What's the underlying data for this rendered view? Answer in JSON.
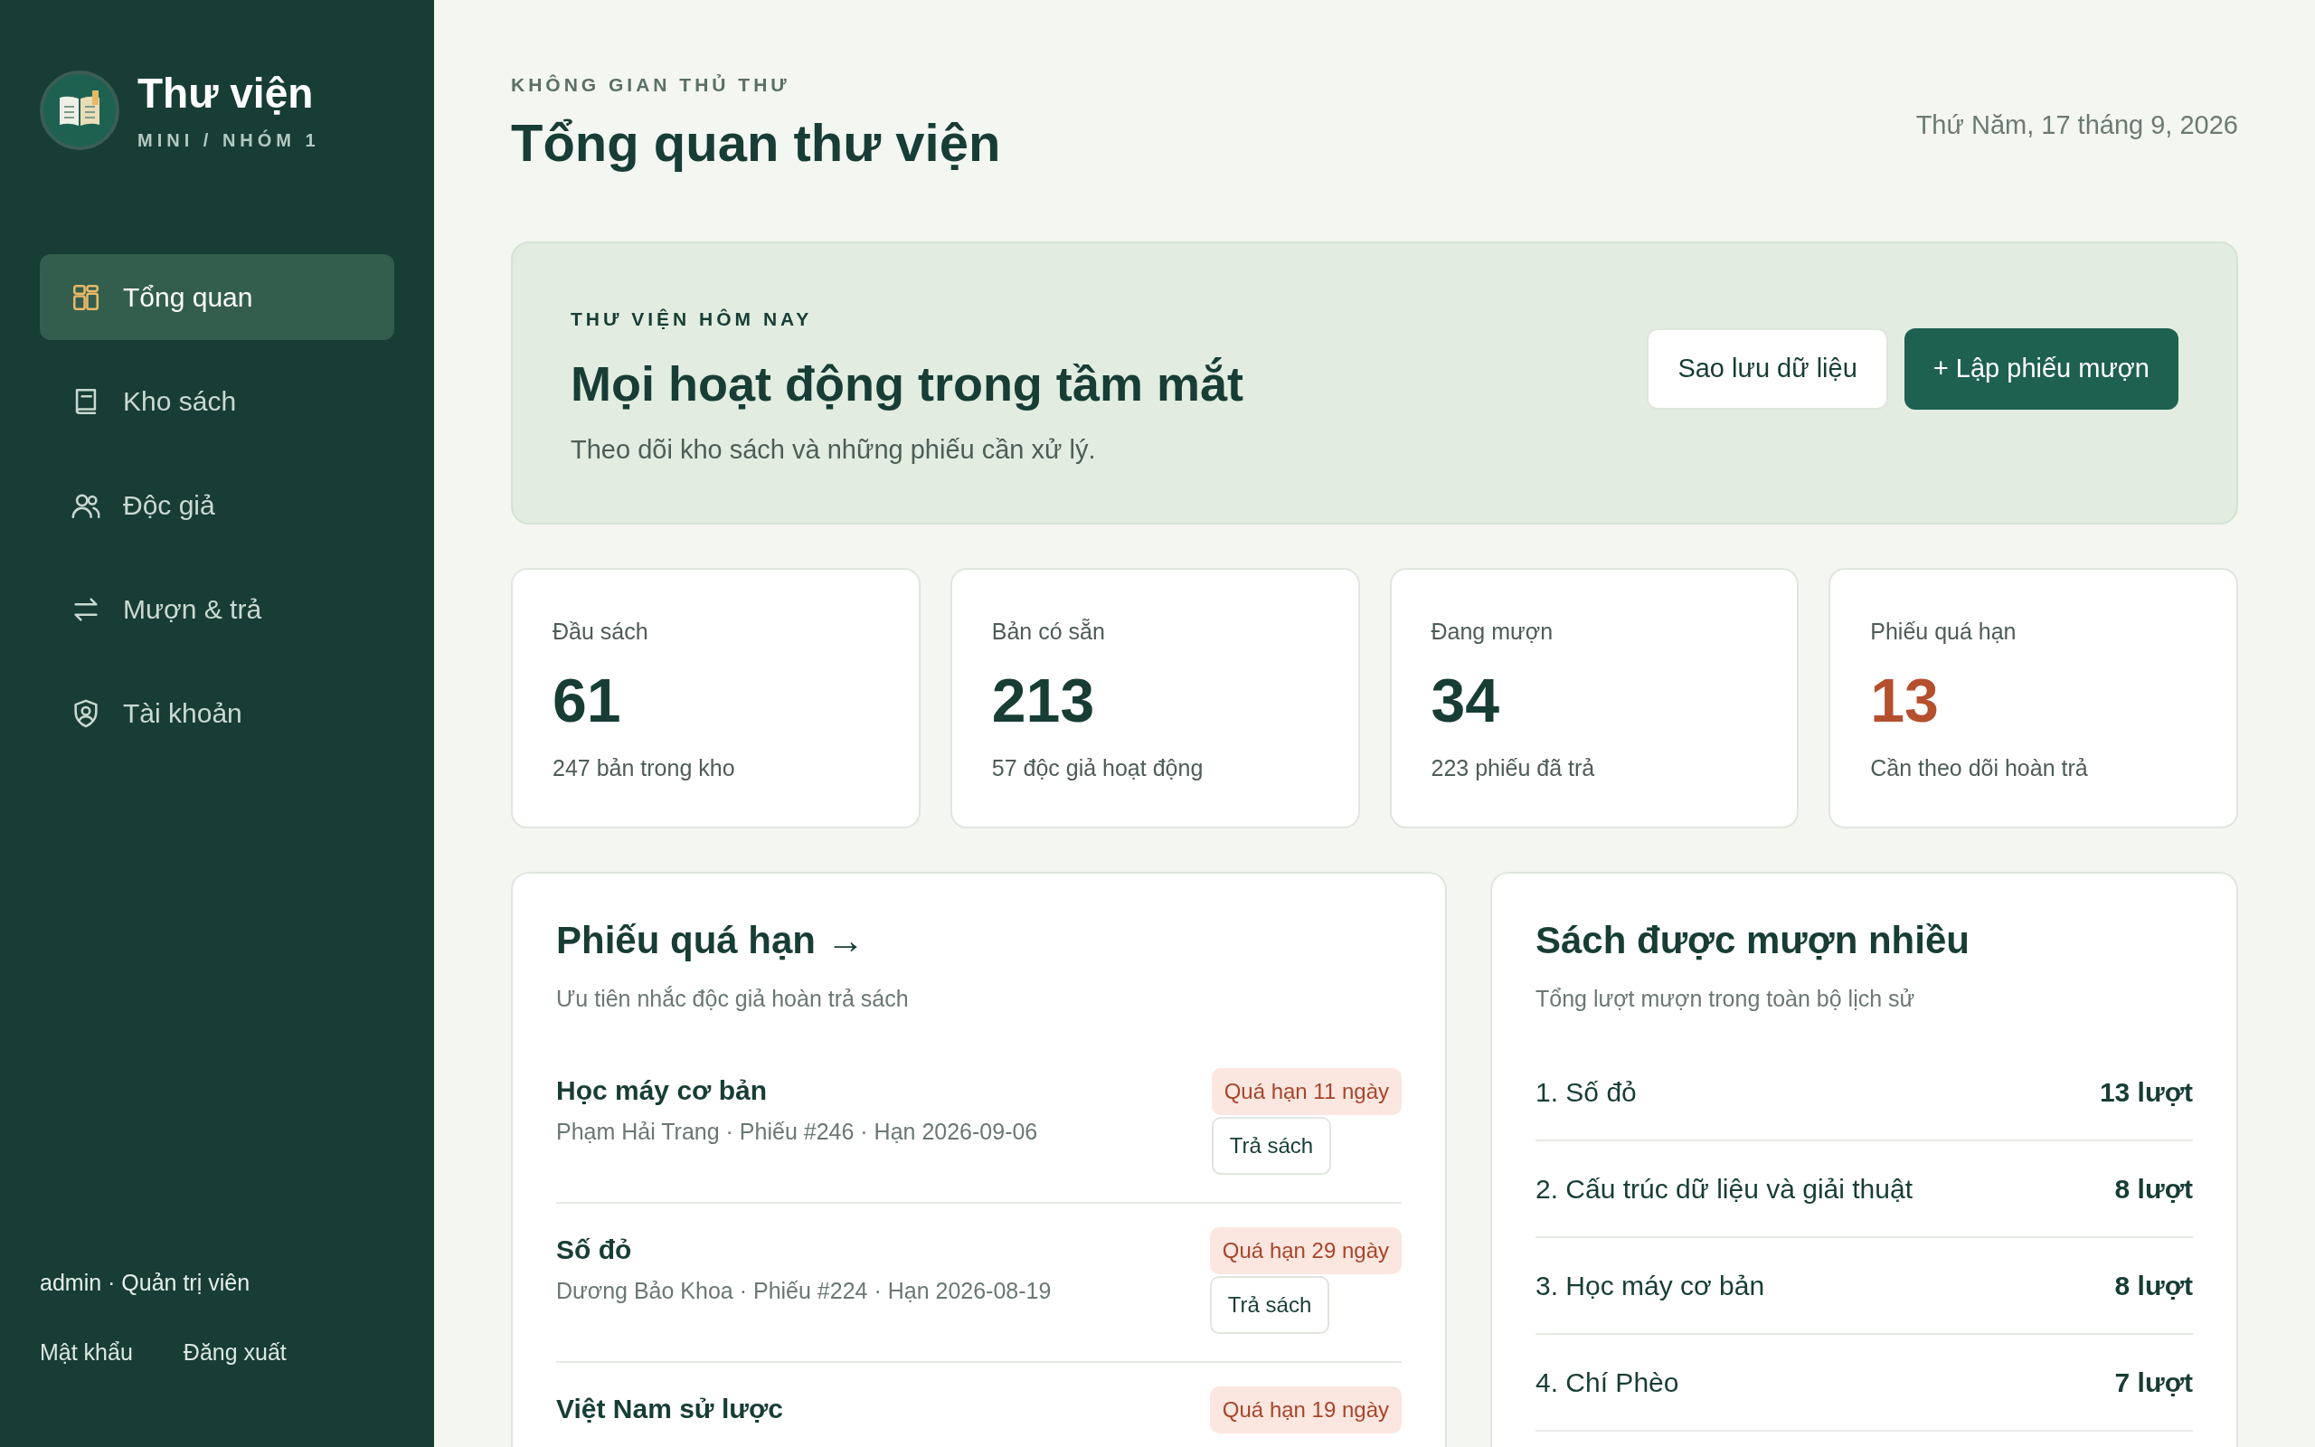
{
  "sidebar": {
    "brand": {
      "title": "Thư viện",
      "subtitle": "MINI / NHÓM 1"
    },
    "nav": [
      {
        "label": "Tổng quan",
        "kind": "grid",
        "selected": true
      },
      {
        "label": "Kho sách",
        "kind": "book",
        "selected": false
      },
      {
        "label": "Độc giả",
        "kind": "users",
        "selected": false
      },
      {
        "label": "Mượn & trả",
        "kind": "swap",
        "selected": false
      },
      {
        "label": "Tài khoản",
        "kind": "shield",
        "selected": false
      }
    ],
    "user": "admin · Quản trị viên",
    "links": [
      "Mật khẩu",
      "Đăng xuất"
    ]
  },
  "header": {
    "eyebrow": "KHÔNG GIAN THỦ THƯ",
    "title": "Tổng quan thư viện",
    "date": "Thứ Năm, 17 tháng 9, 2026"
  },
  "hero": {
    "eyebrow": "THƯ VIỆN HÔM NAY",
    "title": "Mọi hoạt động trong tầm mắt",
    "subtitle": "Theo dõi kho sách và những phiếu cần xử lý.",
    "buttons": [
      {
        "label": "Sao lưu dữ liệu",
        "kind": "secondary"
      },
      {
        "label": "+ Lập phiếu mượn",
        "kind": "primary"
      }
    ]
  },
  "stats": [
    {
      "label": "Đầu sách",
      "value": "61",
      "note": "247 bản trong kho",
      "kind": "normal"
    },
    {
      "label": "Bản có sẵn",
      "value": "213",
      "note": "57 độc giả hoạt động",
      "kind": "normal"
    },
    {
      "label": "Đang mượn",
      "value": "34",
      "note": "223 phiếu đã trả",
      "kind": "normal"
    },
    {
      "label": "Phiếu quá hạn",
      "value": "13",
      "note": "Cần theo dõi hoàn trả",
      "kind": "alert"
    }
  ],
  "overdue": {
    "title": "Phiếu quá hạn →",
    "subtitle": "Ưu tiên nhắc độc giả hoàn trả sách",
    "rows": [
      {
        "title": "Học máy cơ bản",
        "meta": "Phạm Hải Trang · Phiếu #246 · Hạn 2026-09-06",
        "badge": "Quá hạn 11 ngày",
        "action": "Trả sách"
      },
      {
        "title": "Số đỏ",
        "meta": "Dương Bảo Khoa · Phiếu #224 · Hạn 2026-08-19",
        "badge": "Quá hạn 29 ngày",
        "action": "Trả sách"
      },
      {
        "title": "Việt Nam sử lược",
        "badge": "Quá hạn 19 ngày"
      }
    ]
  },
  "popular": {
    "title": "Sách được mượn nhiều",
    "subtitle": "Tổng lượt mượn trong toàn bộ lịch sử",
    "rows": [
      {
        "name": "1. Số đỏ",
        "count": "13 lượt"
      },
      {
        "name": "2. Cấu trúc dữ liệu và giải thuật",
        "count": "8 lượt"
      },
      {
        "name": "3. Học máy cơ bản",
        "count": "8 lượt"
      },
      {
        "name": "4. Chí Phèo",
        "count": "7 lượt"
      }
    ]
  }
}
